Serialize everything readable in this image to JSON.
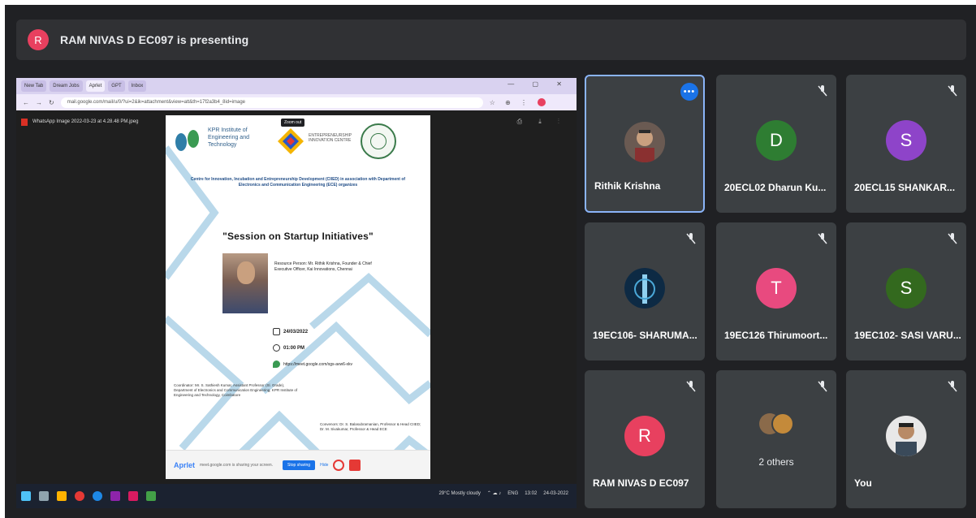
{
  "banner": {
    "avatar_letter": "R",
    "text": "RAM NIVAS D EC097 is presenting",
    "avatar_color": "#e8405f"
  },
  "shared_screen": {
    "tabs": [
      "New Tab",
      "Dream Jobs",
      "Aprlet",
      "GPT",
      "Inbox"
    ],
    "url": "mail.google.com/mail/u/0/?ui=2&ik=attachment&view=att&th=17f2a3b4_8id=image",
    "file_name": "WhatsApp Image 2022-03-23 at 4.28.48 PM.jpeg",
    "tooltip": "Zoom out",
    "poster": {
      "institute_name": "KPR Institute of Engineering and Technology",
      "center_text": "Centre for Innovation, Incubation and Entrepreneurship Development (CIIED) in association with Department of Electronics and Communication Engineering (ECE) organizes",
      "ecell_text": "ENTREPRENEURSHIP INNOVATION CENTRE",
      "session_title": "\"Session on Startup Initiatives\"",
      "resource_person": "Resource Person: Mr. Rithik Krishna, Founder & Chief Executive Officer, Kai Innovations, Chennai",
      "date": "24/03/2022",
      "time": "01:00 PM",
      "link": "https://meet.google.com/xgs-avw6-xkv",
      "coordinator": "Coordinator: Mr. S. Sathiesh Kumar, Assistant Professor (Sl. Grade), Department of Electronics and Communication Engineering, KPR Institute of Engineering and Technology, Coimbatore",
      "convenors": "Convenors: Dr. S. Balasubramanian, Professor & Head CIIED; Dr. M. Sivakumar, Professor & Head ECE"
    },
    "aprlet": {
      "logo": "Aprlet",
      "message": "meet.google.com is sharing your screen.",
      "stop_label": "Stop sharing",
      "hide_label": "Hide"
    },
    "taskbar": {
      "weather": "29°C  Mostly cloudy",
      "time": "13:02",
      "date": "24-03-2022",
      "lang": "ENG"
    }
  },
  "participants": [
    {
      "name": "Rithik Krishna",
      "type": "photo",
      "speaking": true,
      "muted": false
    },
    {
      "name": "20ECL02 Dharun Ku...",
      "letter": "D",
      "color": "#2e7d32",
      "muted": true
    },
    {
      "name": "20ECL15 SHANKAR...",
      "letter": "S",
      "color": "#8e44c9",
      "muted": true
    },
    {
      "name": "19EC106- SHARUMA...",
      "type": "photo",
      "muted": true
    },
    {
      "name": "19EC126 Thirumoort...",
      "letter": "T",
      "color": "#e84a7f",
      "muted": true
    },
    {
      "name": "19EC102- SASI VARU...",
      "letter": "S",
      "color": "#33691e",
      "muted": true
    },
    {
      "name": "RAM NIVAS D EC097",
      "letter": "R",
      "color": "#e8405f",
      "muted": true
    },
    {
      "name": "",
      "type": "others",
      "label": "2 others",
      "muted": true
    },
    {
      "name": "You",
      "type": "photo",
      "muted": true
    }
  ],
  "colors": {
    "background": "#202124",
    "tile": "#3c4043",
    "speaking_border": "#8ab4f8",
    "accent": "#1a73e8"
  }
}
